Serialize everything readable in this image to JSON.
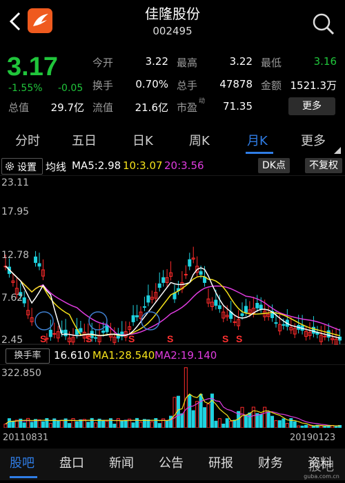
{
  "header": {
    "title": "佳隆股份",
    "code": "002495"
  },
  "quote": {
    "price": "3.17",
    "change_pct": "-1.55%",
    "change_abs": "-0.05",
    "stats": [
      {
        "label": "今开",
        "value": "3.22"
      },
      {
        "label": "最高",
        "value": "3.22"
      },
      {
        "label": "最低",
        "value": "3.16"
      },
      {
        "label": "换手",
        "value": "0.70%"
      },
      {
        "label": "总手",
        "value": "47878"
      },
      {
        "label": "金额",
        "value": "1521.3万"
      },
      {
        "label": "总值",
        "value": "29.7亿"
      },
      {
        "label": "流值",
        "value": "21.6亿"
      },
      {
        "label": "市盈",
        "value": "71.35"
      }
    ],
    "more_label": "更多",
    "pe_superscript": "动"
  },
  "tabs": [
    "分时",
    "五日",
    "日K",
    "周K",
    "月K",
    "更多"
  ],
  "active_tab": "月K",
  "chart_controls": {
    "settings_label": "设置",
    "ma_title": "均线",
    "ma5": "MA5:2.98",
    "ma10": "10:3.07",
    "ma20": "20:3.56",
    "dk_label": "DK点",
    "adjust_label": "不复权"
  },
  "price_axis": [
    "23.11",
    "17.95",
    "12.78",
    "7.62",
    "2.45"
  ],
  "volume_controls": {
    "indicator_label": "换手率",
    "value": "16.610",
    "ma1": "MA1:28.540",
    "ma2": "MA2:19.140"
  },
  "volume_axis_top": "322.850",
  "date_start": "20110831",
  "date_end": "20190123",
  "bottom_nav": [
    "股吧",
    "盘口",
    "新闻",
    "公告",
    "研报",
    "财务",
    "资料"
  ],
  "active_nav": "股吧",
  "watermark": "股吧 guba.com.cn",
  "markers": {
    "s_label": "S"
  },
  "colors": {
    "up": "#ff2b2b",
    "down": "#1fd3e0",
    "ma5": "#ffffff",
    "ma10": "#f5e21a",
    "ma20": "#e03ce0",
    "accent": "#2f7de6",
    "green": "#20c53b"
  }
}
